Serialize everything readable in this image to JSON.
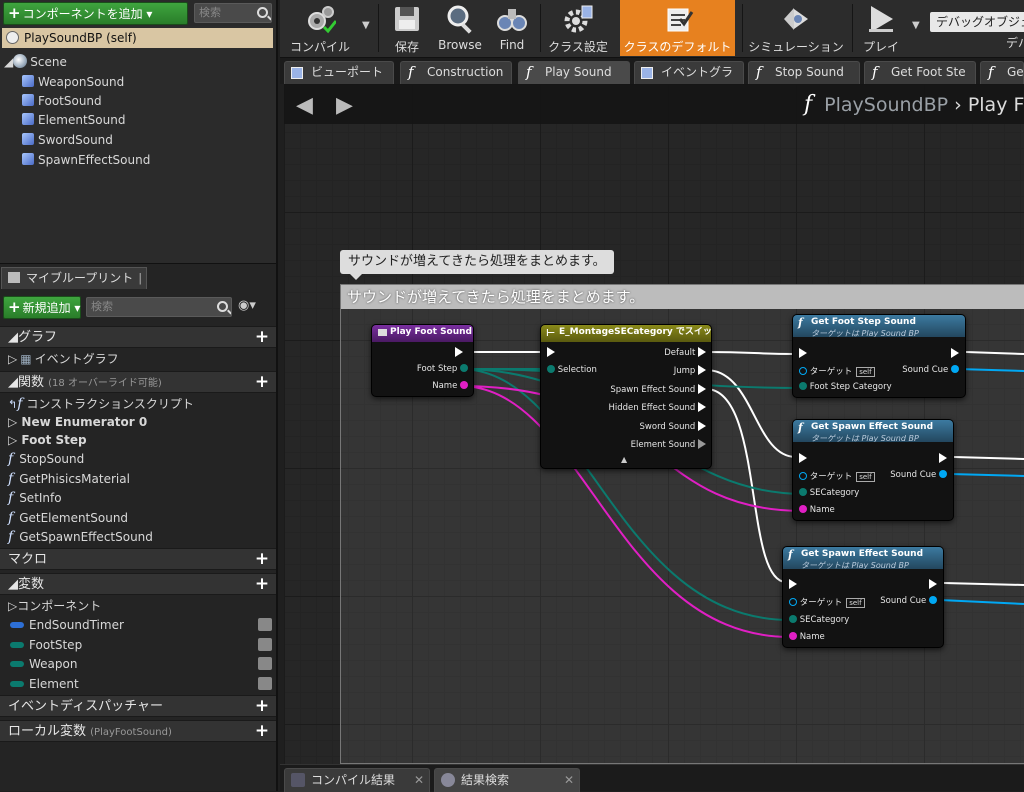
{
  "components": {
    "add_button": "コンポーネントを追加",
    "search_placeholder": "検索",
    "self_item": "PlaySoundBP (self)",
    "scene": "Scene",
    "children": [
      "WeaponSound",
      "FootSound",
      "ElementSound",
      "SwordSound",
      "SpawnEffectSound"
    ]
  },
  "my_blueprint": {
    "tab_label": "マイブループリント",
    "add_new": "新規追加",
    "search_placeholder": "検索",
    "graph_header": "グラフ",
    "event_graph": "イベントグラフ",
    "functions_header": "関数",
    "functions_override": "(18 オーバーライド可能)",
    "construction_script": "コンストラクションスクリプト",
    "new_enumerator": "New Enumerator 0",
    "foot_step": "Foot Step",
    "functions": [
      "StopSound",
      "GetPhisicsMaterial",
      "SetInfo",
      "GetElementSound",
      "GetSpawnEffectSound"
    ],
    "macros_header": "マクロ",
    "variables_header": "変数",
    "components_group": "コンポーネント",
    "variables": [
      {
        "name": "EndSoundTimer",
        "color": "#2d6fd6"
      },
      {
        "name": "FootStep",
        "color": "#0b7a6e"
      },
      {
        "name": "Weapon",
        "color": "#0b7a6e"
      },
      {
        "name": "Element",
        "color": "#0b7a6e"
      }
    ],
    "event_dispatchers_header": "イベントディスパッチャー",
    "local_vars_header": "ローカル変数",
    "local_vars_context": "(PlayFootSound)"
  },
  "toolbar": {
    "compile": "コンパイル",
    "save": "保存",
    "browse": "Browse",
    "find": "Find",
    "class_settings": "クラス設定",
    "class_defaults": "クラスのデフォルト",
    "simulation": "シミュレーション",
    "play": "プレイ",
    "debug_object": "デバッグオブジェクト",
    "debug_object_sub": "デバ"
  },
  "editor_tabs": [
    "ビューポート",
    "Construction",
    "Play Sound",
    "イベントグラ",
    "Stop Sound",
    "Get Foot Ste",
    "Get"
  ],
  "graph": {
    "breadcrumb_root": "PlaySoundBP",
    "breadcrumb_current": "Play F",
    "comment_bubble": "サウンドが増えてきたら処理をまとめます。",
    "comment_title": "サウンドが増えてきたら処理をまとめます。"
  },
  "nodes": {
    "entry": {
      "title": "Play Foot Sound",
      "pins": [
        "Foot Step",
        "Name"
      ]
    },
    "switch": {
      "title": "E_MontageSECategory でスイッチ",
      "selection": "Selection",
      "outputs": [
        "Default",
        "Jump",
        "Spawn Effect Sound",
        "Hidden Effect Sound",
        "Sword Sound",
        "Element Sound"
      ]
    },
    "get_foot": {
      "title": "Get Foot Step Sound",
      "subtitle": "ターゲットは Play Sound BP",
      "target": "ターゲット",
      "self": "self",
      "input": "Foot Step Category",
      "output": "Sound Cue"
    },
    "get_spawn1": {
      "title": "Get Spawn Effect Sound",
      "subtitle": "ターゲットは Play Sound BP",
      "target": "ターゲット",
      "self": "self",
      "input1": "SECategory",
      "input2": "Name",
      "output": "Sound Cue"
    },
    "get_spawn2": {
      "title": "Get Spawn Effect Sound",
      "subtitle": "ターゲットは Play Sound BP",
      "target": "ターゲット",
      "self": "self",
      "input1": "SECategory",
      "input2": "Name",
      "output": "Sound Cue"
    }
  },
  "bottom_tabs": [
    "コンパイル結果",
    "結果検索"
  ],
  "colors": {
    "accent_orange": "#e7811f",
    "enum_pin": "#0b7a6e",
    "name_pin": "#e01fc4",
    "object_pin": "#00a8f4",
    "function_header": "#2f5e7c",
    "event_header": "#6a2a8a",
    "switch_header": "#7a7a14"
  }
}
